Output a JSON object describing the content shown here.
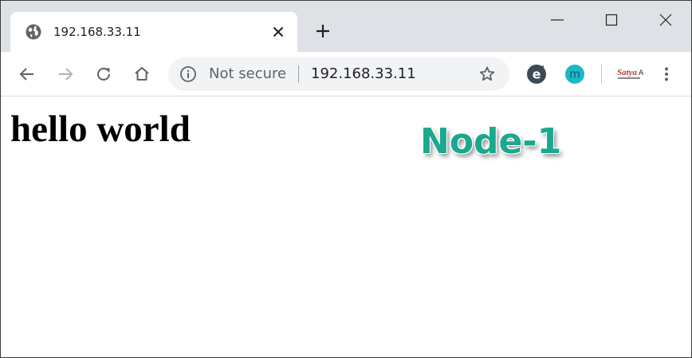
{
  "tab": {
    "title": "192.168.33.11",
    "favicon": "globe-icon",
    "close_icon": "close-icon"
  },
  "window_controls": [
    "minimize-icon",
    "maximize-icon",
    "close-window-icon"
  ],
  "toolbar": {
    "back_icon": "back-arrow-icon",
    "forward_icon": "forward-arrow-icon",
    "reload_icon": "reload-icon",
    "home_icon": "home-icon",
    "menu_icon": "kebab-menu-icon"
  },
  "omnibox": {
    "security_text": "Not secure",
    "url": "192.168.33.11",
    "info_icon": "info-icon",
    "bookmark_icon": "star-icon"
  },
  "extensions": {
    "ext1": "e",
    "ext2": "m",
    "ext3": "Satya"
  },
  "page": {
    "heading": "hello world",
    "overlay_label": "Node-1"
  },
  "colors": {
    "tabstrip": "#dee1e6",
    "omnibox": "#f1f3f4",
    "overlay_label": "#1aa88e",
    "ext_m": "#1bb8c7",
    "ext_e": "#3c4a57"
  }
}
